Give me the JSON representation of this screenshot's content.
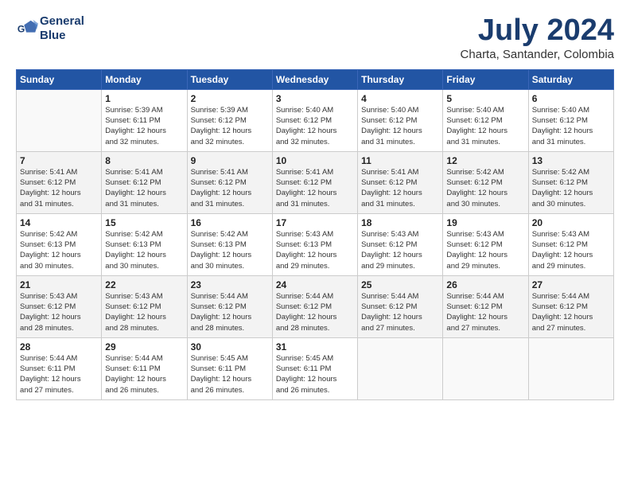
{
  "logo": {
    "line1": "General",
    "line2": "Blue"
  },
  "title": "July 2024",
  "location": "Charta, Santander, Colombia",
  "header_days": [
    "Sunday",
    "Monday",
    "Tuesday",
    "Wednesday",
    "Thursday",
    "Friday",
    "Saturday"
  ],
  "weeks": [
    [
      {
        "day": "",
        "info": ""
      },
      {
        "day": "1",
        "info": "Sunrise: 5:39 AM\nSunset: 6:11 PM\nDaylight: 12 hours\nand 32 minutes."
      },
      {
        "day": "2",
        "info": "Sunrise: 5:39 AM\nSunset: 6:12 PM\nDaylight: 12 hours\nand 32 minutes."
      },
      {
        "day": "3",
        "info": "Sunrise: 5:40 AM\nSunset: 6:12 PM\nDaylight: 12 hours\nand 32 minutes."
      },
      {
        "day": "4",
        "info": "Sunrise: 5:40 AM\nSunset: 6:12 PM\nDaylight: 12 hours\nand 31 minutes."
      },
      {
        "day": "5",
        "info": "Sunrise: 5:40 AM\nSunset: 6:12 PM\nDaylight: 12 hours\nand 31 minutes."
      },
      {
        "day": "6",
        "info": "Sunrise: 5:40 AM\nSunset: 6:12 PM\nDaylight: 12 hours\nand 31 minutes."
      }
    ],
    [
      {
        "day": "7",
        "info": "Sunrise: 5:41 AM\nSunset: 6:12 PM\nDaylight: 12 hours\nand 31 minutes."
      },
      {
        "day": "8",
        "info": "Sunrise: 5:41 AM\nSunset: 6:12 PM\nDaylight: 12 hours\nand 31 minutes."
      },
      {
        "day": "9",
        "info": "Sunrise: 5:41 AM\nSunset: 6:12 PM\nDaylight: 12 hours\nand 31 minutes."
      },
      {
        "day": "10",
        "info": "Sunrise: 5:41 AM\nSunset: 6:12 PM\nDaylight: 12 hours\nand 31 minutes."
      },
      {
        "day": "11",
        "info": "Sunrise: 5:41 AM\nSunset: 6:12 PM\nDaylight: 12 hours\nand 31 minutes."
      },
      {
        "day": "12",
        "info": "Sunrise: 5:42 AM\nSunset: 6:12 PM\nDaylight: 12 hours\nand 30 minutes."
      },
      {
        "day": "13",
        "info": "Sunrise: 5:42 AM\nSunset: 6:12 PM\nDaylight: 12 hours\nand 30 minutes."
      }
    ],
    [
      {
        "day": "14",
        "info": "Sunrise: 5:42 AM\nSunset: 6:13 PM\nDaylight: 12 hours\nand 30 minutes."
      },
      {
        "day": "15",
        "info": "Sunrise: 5:42 AM\nSunset: 6:13 PM\nDaylight: 12 hours\nand 30 minutes."
      },
      {
        "day": "16",
        "info": "Sunrise: 5:42 AM\nSunset: 6:13 PM\nDaylight: 12 hours\nand 30 minutes."
      },
      {
        "day": "17",
        "info": "Sunrise: 5:43 AM\nSunset: 6:13 PM\nDaylight: 12 hours\nand 29 minutes."
      },
      {
        "day": "18",
        "info": "Sunrise: 5:43 AM\nSunset: 6:12 PM\nDaylight: 12 hours\nand 29 minutes."
      },
      {
        "day": "19",
        "info": "Sunrise: 5:43 AM\nSunset: 6:12 PM\nDaylight: 12 hours\nand 29 minutes."
      },
      {
        "day": "20",
        "info": "Sunrise: 5:43 AM\nSunset: 6:12 PM\nDaylight: 12 hours\nand 29 minutes."
      }
    ],
    [
      {
        "day": "21",
        "info": "Sunrise: 5:43 AM\nSunset: 6:12 PM\nDaylight: 12 hours\nand 28 minutes."
      },
      {
        "day": "22",
        "info": "Sunrise: 5:43 AM\nSunset: 6:12 PM\nDaylight: 12 hours\nand 28 minutes."
      },
      {
        "day": "23",
        "info": "Sunrise: 5:44 AM\nSunset: 6:12 PM\nDaylight: 12 hours\nand 28 minutes."
      },
      {
        "day": "24",
        "info": "Sunrise: 5:44 AM\nSunset: 6:12 PM\nDaylight: 12 hours\nand 28 minutes."
      },
      {
        "day": "25",
        "info": "Sunrise: 5:44 AM\nSunset: 6:12 PM\nDaylight: 12 hours\nand 27 minutes."
      },
      {
        "day": "26",
        "info": "Sunrise: 5:44 AM\nSunset: 6:12 PM\nDaylight: 12 hours\nand 27 minutes."
      },
      {
        "day": "27",
        "info": "Sunrise: 5:44 AM\nSunset: 6:12 PM\nDaylight: 12 hours\nand 27 minutes."
      }
    ],
    [
      {
        "day": "28",
        "info": "Sunrise: 5:44 AM\nSunset: 6:11 PM\nDaylight: 12 hours\nand 27 minutes."
      },
      {
        "day": "29",
        "info": "Sunrise: 5:44 AM\nSunset: 6:11 PM\nDaylight: 12 hours\nand 26 minutes."
      },
      {
        "day": "30",
        "info": "Sunrise: 5:45 AM\nSunset: 6:11 PM\nDaylight: 12 hours\nand 26 minutes."
      },
      {
        "day": "31",
        "info": "Sunrise: 5:45 AM\nSunset: 6:11 PM\nDaylight: 12 hours\nand 26 minutes."
      },
      {
        "day": "",
        "info": ""
      },
      {
        "day": "",
        "info": ""
      },
      {
        "day": "",
        "info": ""
      }
    ]
  ]
}
